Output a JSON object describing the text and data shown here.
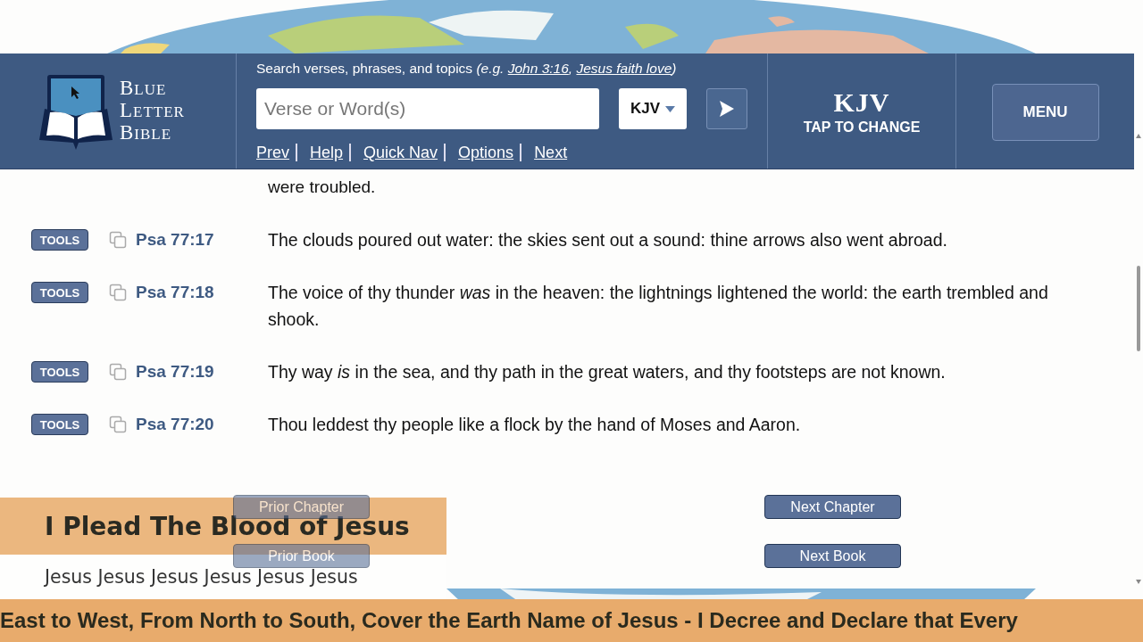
{
  "logo": {
    "lines": [
      "BLUE",
      "LETTER",
      "BIBLE"
    ]
  },
  "search": {
    "prompt": "Search verses, phrases, and topics *(e.g.*",
    "examples": [
      "John 3:16",
      "Jesus faith love"
    ],
    "example_separator": ",",
    "example_close": ")",
    "placeholder": "Verse or Word(s)",
    "version": "KJV"
  },
  "nav_links": [
    "Prev",
    "Help",
    "Quick Nav",
    "Options",
    "Next"
  ],
  "version_panel": {
    "version": "KJV",
    "action": "TAP TO CHANGE"
  },
  "menu_button": "MENU",
  "continuation": "were troubled.",
  "verses": [
    {
      "tools": "TOOLS",
      "ref": "Psa 77:17",
      "text": "The clouds poured out water: the skies sent out a sound: thine arrows also went abroad."
    },
    {
      "tools": "TOOLS",
      "ref": "Psa 77:18",
      "text": "The voice of thy thunder *was* in the heaven: the lightnings lightened the world: the earth trembled and shook."
    },
    {
      "tools": "TOOLS",
      "ref": "Psa 77:19",
      "text": "Thy way *is* in the sea, and thy path in the great waters, and thy footsteps are not known."
    },
    {
      "tools": "TOOLS",
      "ref": "Psa 77:20",
      "text": "Thou leddest thy people like a flock by the hand of Moses and Aaron."
    }
  ],
  "chapter_nav": {
    "prior": [
      {
        "label": "Prior Chapter",
        "disabled": true
      },
      {
        "label": "Prior Book",
        "disabled": true
      }
    ],
    "next": [
      {
        "label": "Next Chapter",
        "disabled": false
      },
      {
        "label": "Next Book",
        "disabled": false
      }
    ]
  },
  "overlay": {
    "title": "I Plead The Blood of Jesus",
    "subtitle": "Jesus Jesus Jesus Jesus Jesus Jesus",
    "ticker": "East to West, From North to South, Cover the Earth Name of Jesus - I Decree and Declare that Every"
  }
}
